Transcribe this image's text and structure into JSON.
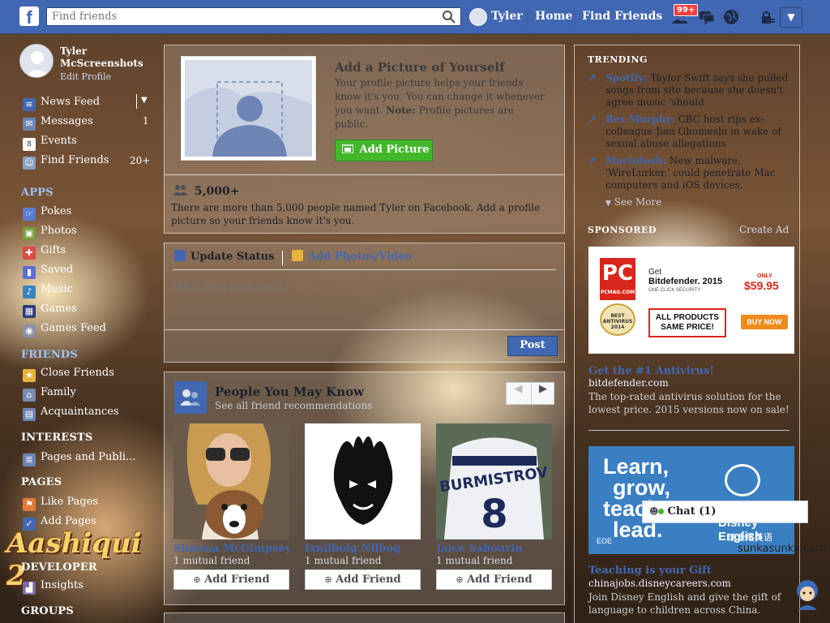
{
  "topbar": {
    "logo": "f",
    "search_placeholder": "Find friends",
    "user_name": "Tyler",
    "home": "Home",
    "find_friends": "Find Friends",
    "notif_count": "99+"
  },
  "sidebar": {
    "profile_name": "Tyler McScreenshots",
    "profile_sub": "Edit Profile",
    "items": [
      {
        "label": "News Feed",
        "count": ""
      },
      {
        "label": "Messages",
        "count": "1"
      },
      {
        "label": "Events",
        "count": ""
      },
      {
        "label": "Find Friends",
        "count": "20+"
      }
    ],
    "apps_head": "APPS",
    "apps": [
      "Pokes",
      "Photos",
      "Gifts",
      "Saved",
      "Music",
      "Games",
      "Games Feed"
    ],
    "friends_head": "FRIENDS",
    "friends": [
      "Close Friends",
      "Family",
      "Acquaintances"
    ],
    "interests_head": "INTERESTS",
    "interests": [
      "Pages and Publi..."
    ],
    "pages_head": "PAGES",
    "pages": [
      "Like Pages",
      "Add Pages"
    ],
    "developer_head": "DEVELOPER",
    "developer": [
      "Insights"
    ],
    "groups_head": "GROUPS",
    "brand_logo": "Aashiqui 2"
  },
  "add_picture": {
    "title": "Add a Picture of Yourself",
    "desc_plain": "Your profile picture helps your friends know it's you. You can change it whenever you want. ",
    "note_label": "Note:",
    "note_text": " Profile pictures are public.",
    "button": "Add Picture",
    "count_title": "5,000+",
    "count_desc": "There are more than 5,000 people named Tyler on Facebook. Add a profile picture so your friends know it's you."
  },
  "composer": {
    "tab_status": "Update Status",
    "tab_photo": "Add Photos/Video",
    "placeholder": "What's on your mind?",
    "post": "Post"
  },
  "pymk": {
    "title": "People You May Know",
    "subtitle": "See all friend recommendations",
    "people": [
      {
        "name": "Shawna McGimpsey",
        "mutual": "1 mutual friend",
        "button": "Add Friend"
      },
      {
        "name": "Ixniibolg Nilbog",
        "mutual": "1 mutual friend",
        "button": "Add Friend"
      },
      {
        "name": "Jaice Sabourin",
        "mutual": "1 mutual friend",
        "button": "Add Friend"
      }
    ]
  },
  "trending": {
    "head": "TRENDING",
    "items": [
      {
        "topic": "Spotify:",
        "text": " Taylor Swift says she pulled songs from site because she doesn't agree music 'should"
      },
      {
        "topic": "Rex Murphy:",
        "text": " CBC host rips ex-colleague Jian Ghomeshi in wake of sexual abuse allegations"
      },
      {
        "topic": "Macintosh:",
        "text": " New malware, 'WireLurker,' could penetrate Mac computers and iOS devices,"
      }
    ],
    "see_more": "See More"
  },
  "sponsored": {
    "head": "SPONSORED",
    "create_ad": "Create Ad",
    "ad1": {
      "pc_logo": "PC",
      "pc_sub": "PCMAG.COM",
      "award": "BEST ANTIVIRUS 2014",
      "get": "Get",
      "product": "Bitdefender. 2015",
      "one_click": "ONE CLICK SECURITY",
      "only": "ONLY",
      "price": "$59.95",
      "all_products": "ALL PRODUCTS SAME PRICE!",
      "buy": "BUY NOW",
      "title": "Get the #1 Antivirus!",
      "domain": "bitdefender.com",
      "desc": "The top-rated antivirus solution for the lowest price. 2015 versions now on sale!"
    },
    "ad2": {
      "line1": "Learn,",
      "line2": "grow,",
      "line3": "teach,",
      "line4": "lead.",
      "brand": "Disney English",
      "brand_cn": "迪士尼英语",
      "eoe": "EOE",
      "title": "Teaching is your Gift",
      "domain": "chinajobs.disneycareers.com",
      "desc": "Join Disney English and give the gift of language to children across China."
    }
  },
  "chat": {
    "label": "Chat (1)"
  },
  "watermark": "sunkasunka.com"
}
